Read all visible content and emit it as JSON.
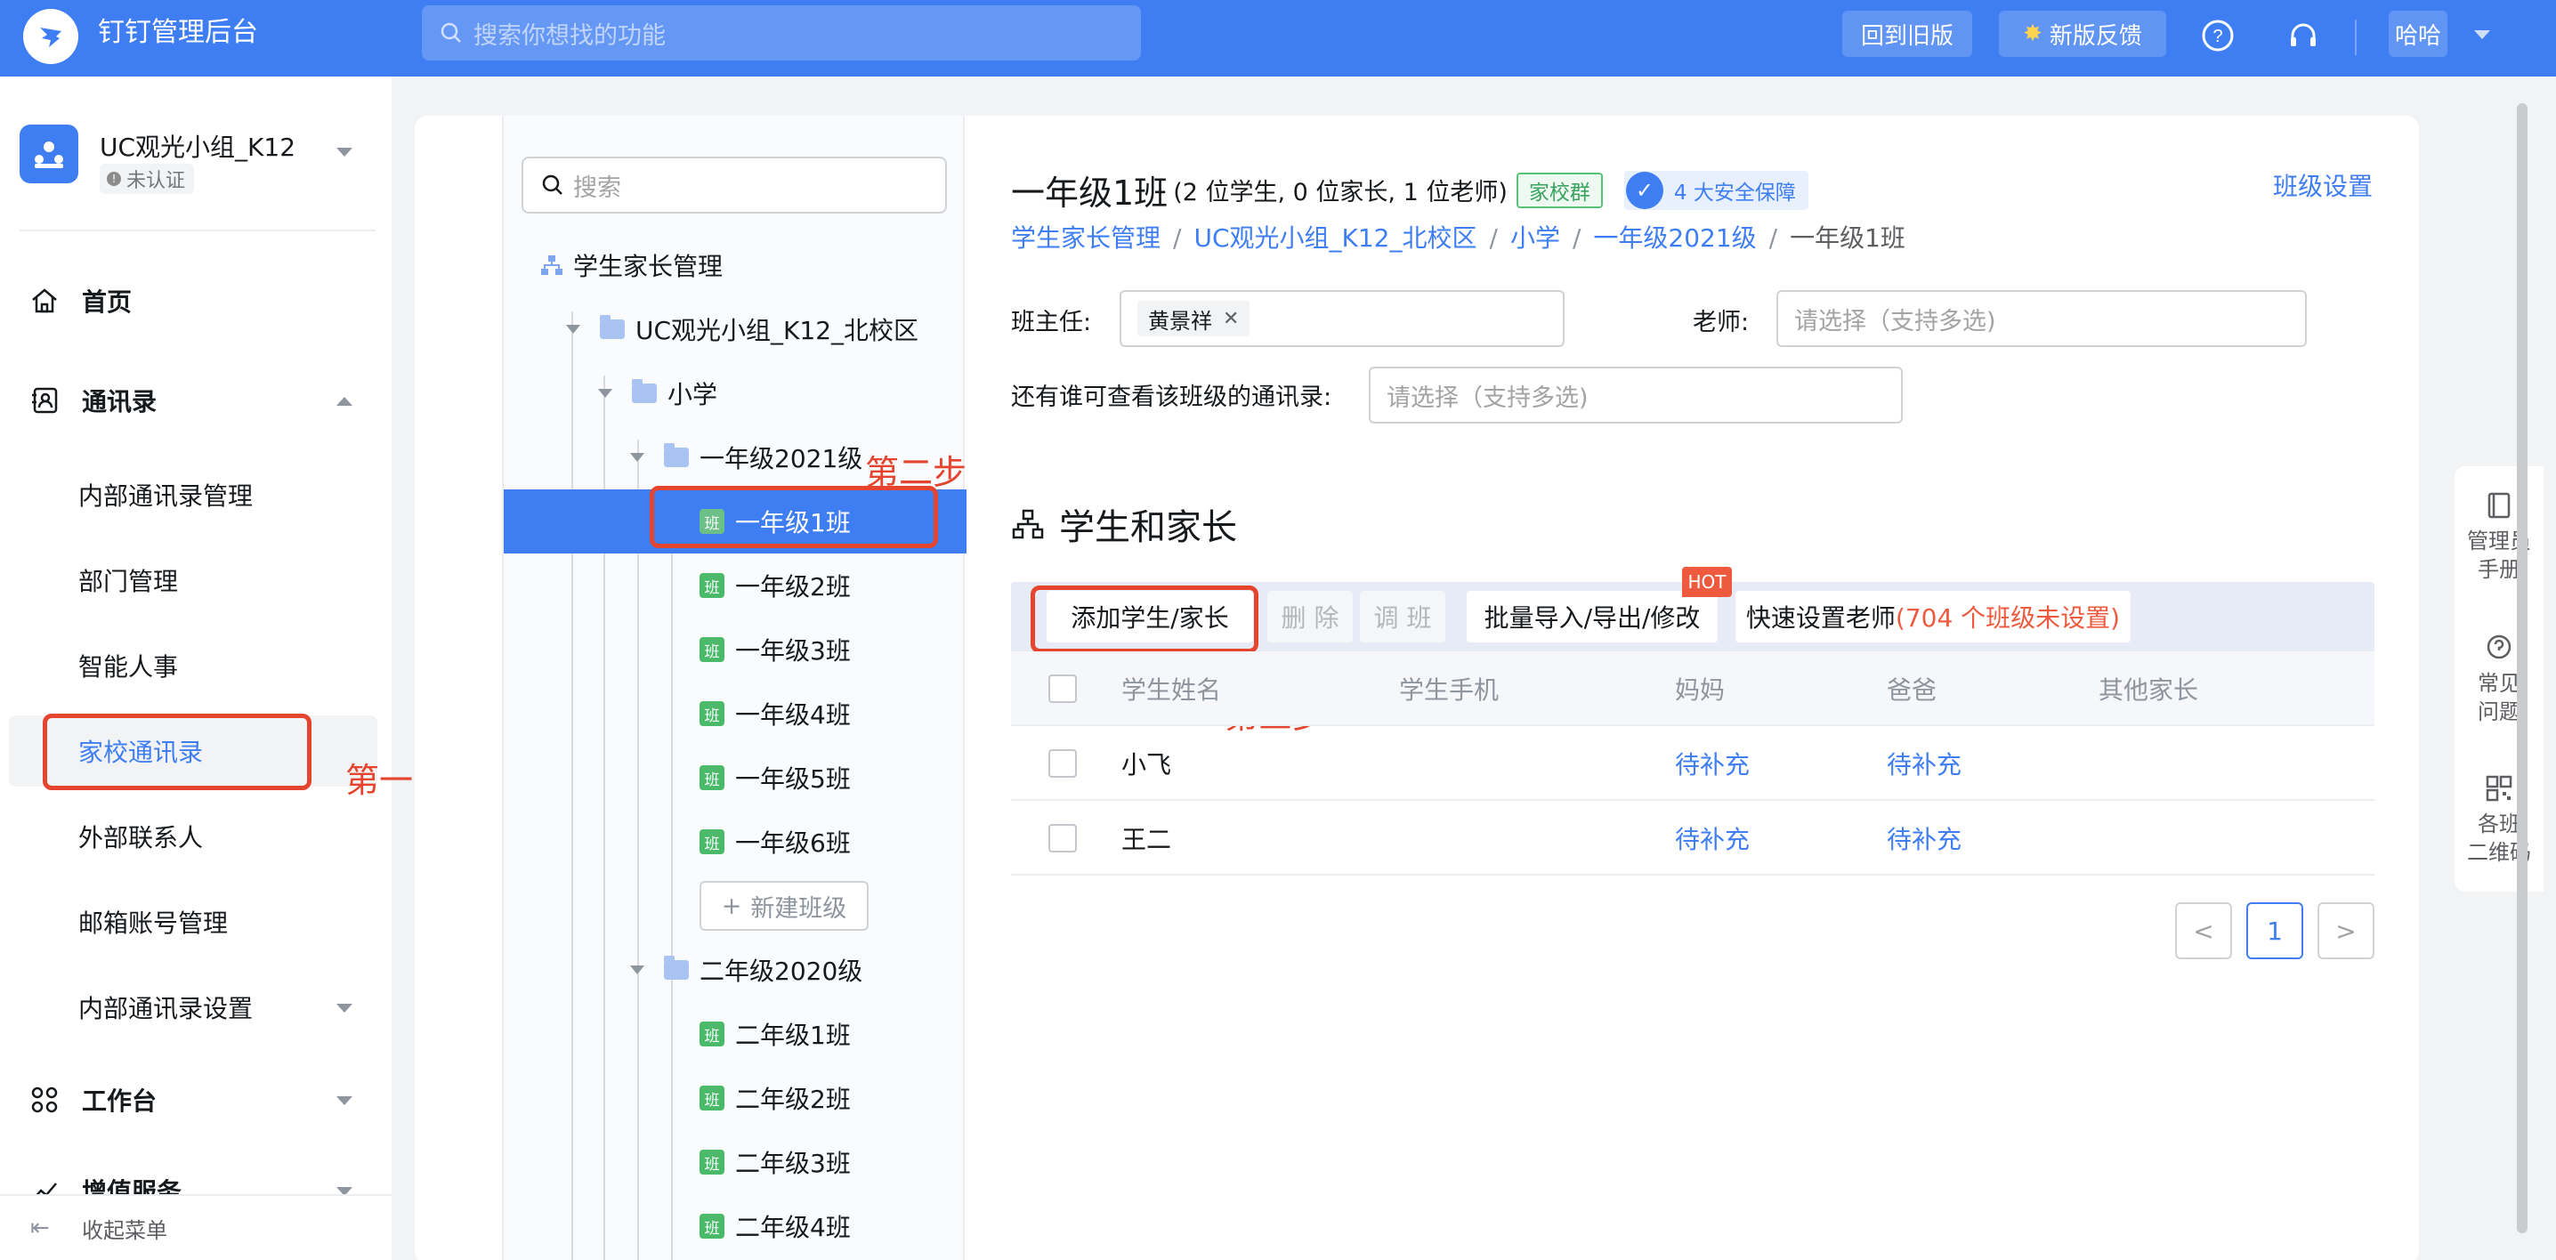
{
  "topbar": {
    "app_title": "钉钉管理后台",
    "search_placeholder": "搜索你想找的功能",
    "btn_old_version": "回到旧版",
    "btn_feedback": "新版反馈",
    "user_name": "哈哈"
  },
  "sidebar": {
    "org_name": "UC观光小组_K12",
    "org_status": "未认证",
    "nav_home": "首页",
    "nav_contacts": "通讯录",
    "sub_items": [
      "内部通讯录管理",
      "部门管理",
      "智能人事",
      "家校通讯录",
      "外部联系人",
      "邮箱账号管理",
      "内部通讯录设置"
    ],
    "nav_workbench": "工作台",
    "nav_value_service": "增值服务",
    "collapse_menu": "收起菜单"
  },
  "annotations": {
    "step1": "第一步",
    "step2": "第二步",
    "step3": "第三步"
  },
  "tree": {
    "search_placeholder": "搜索",
    "root": "学生家长管理",
    "campus": "UC观光小组_K12_北校区",
    "school": "小学",
    "grade1": "一年级2021级",
    "grade1_classes": [
      "一年级1班",
      "一年级2班",
      "一年级3班",
      "一年级4班",
      "一年级5班",
      "一年级6班"
    ],
    "class_badge": "班",
    "new_class": "新建班级",
    "grade2": "二年级2020级",
    "grade2_classes": [
      "二年级1班",
      "二年级2班",
      "二年级3班",
      "二年级4班"
    ]
  },
  "class_detail": {
    "title": "一年级1班",
    "counts": "(2 位学生, 0 位家长, 1 位老师)",
    "tag_group": "家校群",
    "tag_security": "4 大安全保障",
    "class_settings": "班级设置",
    "breadcrumb": [
      "学生家长管理",
      "UC观光小组_K12_北校区",
      "小学",
      "一年级2021级",
      "一年级1班"
    ],
    "head_teacher_label": "班主任:",
    "head_teacher_value": "黄景祥",
    "teacher_label": "老师:",
    "teacher_placeholder": "请选择（支持多选)",
    "viewers_label": "还有谁可查看该班级的通讯录:",
    "viewers_placeholder": "请选择（支持多选)"
  },
  "students_section": {
    "title": "学生和家长",
    "btn_add": "添加学生/家长",
    "btn_delete": "删 除",
    "btn_transfer": "调 班",
    "btn_import": "批量导入/导出/修改",
    "btn_quick_set": "快速设置老师",
    "quick_set_note": "(704 个班级未设置)",
    "hot_badge": "HOT",
    "columns": [
      "学生姓名",
      "学生手机",
      "妈妈",
      "爸爸",
      "其他家长"
    ],
    "rows": [
      {
        "name": "小飞",
        "phone": "",
        "mom": "待补充",
        "dad": "待补充",
        "other": ""
      },
      {
        "name": "王二",
        "phone": "",
        "mom": "待补充",
        "dad": "待补充",
        "other": ""
      }
    ],
    "page_prev": "<",
    "page_current": "1",
    "page_next": ">"
  },
  "right_help": {
    "manual": [
      "管理员",
      "手册"
    ],
    "faq": [
      "常见",
      "问题"
    ],
    "qrcode": [
      "各班",
      "二维码"
    ]
  },
  "colors": {
    "brand_blue": "#3f7ef2",
    "annotation_red": "#e5442f",
    "hot_orange": "#ee5a3e",
    "class_green": "#4cba6b"
  }
}
